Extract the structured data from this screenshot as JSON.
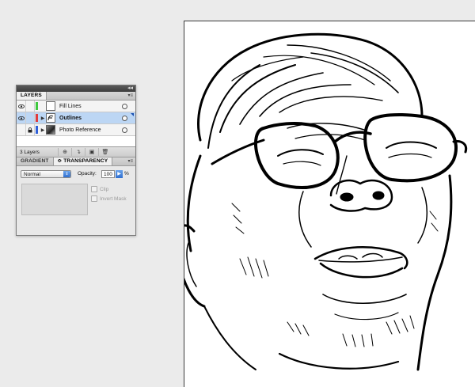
{
  "layers_panel": {
    "tab_label": "LAYERS",
    "collapse_glyph": "◂◂",
    "menu_glyph": "▾≡",
    "layers": [
      {
        "name": "Fill Lines",
        "color": "#3ec93e",
        "selected": false,
        "visible": true,
        "locked": false,
        "expandable": false
      },
      {
        "name": "Outlines",
        "color": "#e23b3b",
        "selected": true,
        "visible": true,
        "locked": false,
        "expandable": true
      },
      {
        "name": "Photo Reference",
        "color": "#2f5fd8",
        "selected": false,
        "visible": false,
        "locked": true,
        "expandable": true
      }
    ],
    "count_label": "3 Layers",
    "footer_buttons": [
      {
        "name": "make-clipping-mask-icon",
        "glyph": "⊕"
      },
      {
        "name": "create-sublayer-icon",
        "glyph": "↴"
      },
      {
        "name": "create-new-layer-icon",
        "glyph": "▣"
      },
      {
        "name": "delete-layer-icon",
        "glyph": "🗑"
      }
    ]
  },
  "transparency_panel": {
    "tab_gradient": "GRADIENT",
    "tab_transparency": "≎ TRANSPARENCY",
    "blend_mode": "Normal",
    "opacity_label": "Opacity:",
    "opacity_value": "100",
    "opacity_unit": "%",
    "clip_label": "Clip",
    "invert_mask_label": "Invert Mask"
  }
}
